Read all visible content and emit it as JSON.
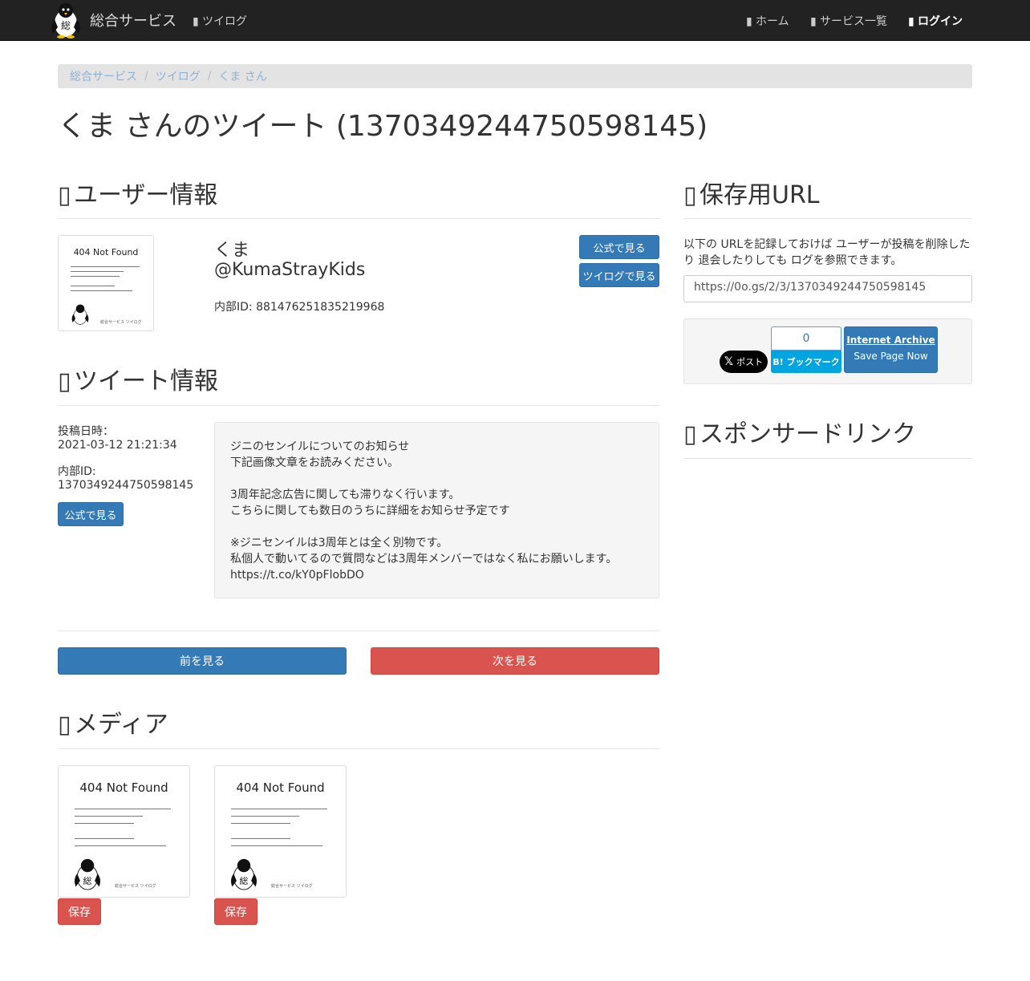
{
  "navbar": {
    "brand": "総合サービス",
    "twilog": "ツイログ",
    "home": "ホーム",
    "services": "サービス一覧",
    "login": "ログイン"
  },
  "breadcrumb": [
    "総合サービス",
    "ツイログ",
    "くま さん"
  ],
  "page_title": "くま さんのツイート (1370349244750598145)",
  "user_section": {
    "heading": "ユーザー情報",
    "display_name": "くま",
    "screen_name": "@KumaStrayKids",
    "internal_id": "内部ID: 881476251835219968",
    "view_official": "公式で見る",
    "view_twilog": "ツイログで見る"
  },
  "tweet_section": {
    "heading": "ツイート情報",
    "posted_label": "投稿日時：",
    "posted_value": "2021-03-12 21:21:34",
    "id_label": "内部ID:",
    "id_value": "1370349244750598145",
    "view_official": "公式で見る",
    "body": [
      "ジニのセンイルについてのお知らせ",
      "下記画像文章をお読みください。",
      "",
      "3周年記念広告に関しても滞りなく行います。",
      "こちらに関しても数日のうちに詳細をお知らせ予定です",
      "",
      "※ジニセンイルは3周年とは全く別物です。",
      "私個人で動いてるので質問などは3周年メンバーではなく私にお願いします。",
      "https://t.co/kY0pFlobDO"
    ]
  },
  "pager": {
    "prev": "前を見る",
    "next": "次を見る"
  },
  "media_section": {
    "heading": "メディア",
    "save_label": "保存"
  },
  "not_found": {
    "title": "404 Not Found",
    "lines": [
      "ユーザーがツイートを削除したなどの理由により、",
      "画像がTwitterのサーバー上から",
      "削除された可能性があります。",
      "画像には著作権などが絡むため",
      "当サイトのサーバーには保存しておりません。"
    ],
    "footer": "総合サービス ツイログ"
  },
  "save_url_section": {
    "heading": "保存用URL",
    "description_1": "以下の URLを記録しておけば ユーザーが投稿を削除した",
    "description_2": "り 退会したりしても ログを参照できます。",
    "url": "https://0o.gs/2/3/1370349244750598145"
  },
  "share": {
    "x_label": "ポスト",
    "hatena_count": "0",
    "hatena_label": "B! ブックマーク",
    "ia_title": "Internet Archive",
    "ia_sub": "Save Page Now"
  },
  "sponsor_section": {
    "heading": "スポンサードリンク"
  }
}
